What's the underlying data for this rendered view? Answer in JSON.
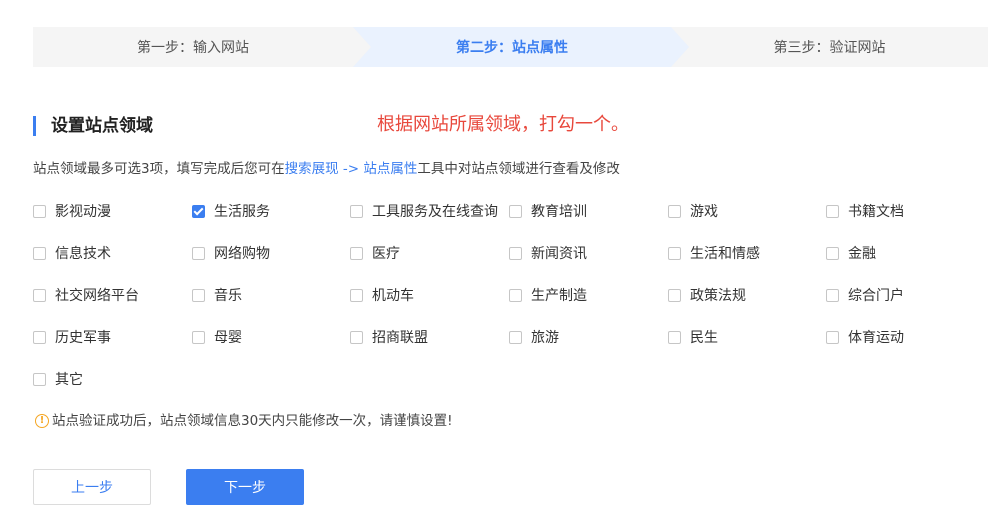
{
  "steps": {
    "step1": "第一步：输入网站",
    "step2": "第二步：站点属性",
    "step3": "第三步：验证网站"
  },
  "section": {
    "title": "设置站点领域",
    "annotation": "根据网站所属领域，打勾一个。"
  },
  "description": {
    "prefix": "站点领域最多可选3项，填写完成后您可在",
    "link1": "搜索展现",
    "arrow": " -> ",
    "link2": "站点属性",
    "suffix": "工具中对站点领域进行查看及修改"
  },
  "categories": [
    {
      "label": "影视动漫",
      "checked": false
    },
    {
      "label": "生活服务",
      "checked": true
    },
    {
      "label": "工具服务及在线查询",
      "checked": false
    },
    {
      "label": "教育培训",
      "checked": false
    },
    {
      "label": "游戏",
      "checked": false
    },
    {
      "label": "书籍文档",
      "checked": false
    },
    {
      "label": "信息技术",
      "checked": false
    },
    {
      "label": "网络购物",
      "checked": false
    },
    {
      "label": "医疗",
      "checked": false
    },
    {
      "label": "新闻资讯",
      "checked": false
    },
    {
      "label": "生活和情感",
      "checked": false
    },
    {
      "label": "金融",
      "checked": false
    },
    {
      "label": "社交网络平台",
      "checked": false
    },
    {
      "label": "音乐",
      "checked": false
    },
    {
      "label": "机动车",
      "checked": false
    },
    {
      "label": "生产制造",
      "checked": false
    },
    {
      "label": "政策法规",
      "checked": false
    },
    {
      "label": "综合门户",
      "checked": false
    },
    {
      "label": "历史军事",
      "checked": false
    },
    {
      "label": "母婴",
      "checked": false
    },
    {
      "label": "招商联盟",
      "checked": false
    },
    {
      "label": "旅游",
      "checked": false
    },
    {
      "label": "民生",
      "checked": false
    },
    {
      "label": "体育运动",
      "checked": false
    },
    {
      "label": "其它",
      "checked": false
    }
  ],
  "warning": {
    "icon": "warning-icon",
    "text": "站点验证成功后，站点领域信息30天内只能修改一次，请谨慎设置!"
  },
  "buttons": {
    "prev": "上一步",
    "next": "下一步"
  },
  "colors": {
    "accent": "#3b7ef0",
    "annotation": "#e8483c",
    "warning": "#f5a623"
  }
}
